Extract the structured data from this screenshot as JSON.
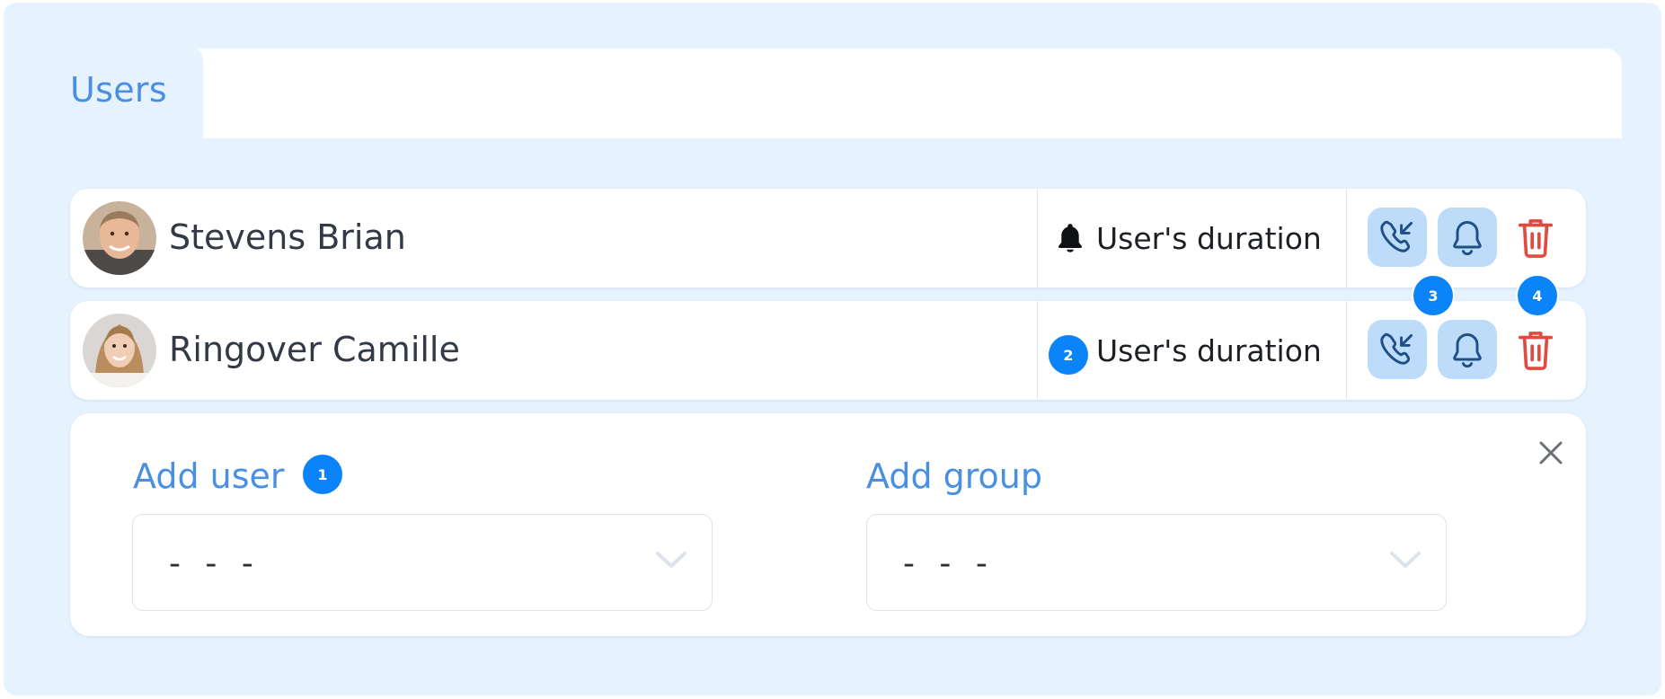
{
  "tabs": [
    {
      "label": "Users"
    }
  ],
  "users": [
    {
      "name": "Stevens Brian",
      "duration_label": "User's duration"
    },
    {
      "name": "Ringover Camille",
      "duration_label": "User's duration"
    }
  ],
  "add_panel": {
    "add_user_label": "Add user",
    "add_user_value": "- - -",
    "add_group_label": "Add group",
    "add_group_value": "- - -"
  },
  "markers": [
    "1",
    "2",
    "3",
    "4"
  ],
  "icons": {
    "duration": "bell-solid-icon",
    "call": "incoming-call-icon",
    "notify": "bell-outline-icon",
    "delete": "trash-icon",
    "close": "close-icon",
    "dropdown": "chevron-down-icon"
  },
  "colors": {
    "accent": "#4a90e2",
    "panel_bg": "#e6f2fd",
    "action_bg": "#bcdcfa",
    "action_icon": "#1f4f86",
    "delete": "#e04a3f",
    "marker": "#0a84f8"
  }
}
